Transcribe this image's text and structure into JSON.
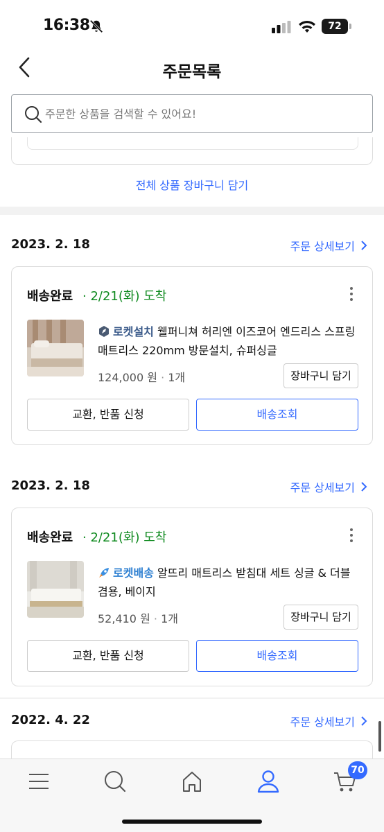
{
  "status_bar": {
    "time": "16:38",
    "battery": "72"
  },
  "header": {
    "title": "주문목록"
  },
  "search": {
    "placeholder": "주문한 상품을 검색할 수 있어요!"
  },
  "prev_card": {
    "cart_all_label": "전체 상품 장바구니 담기"
  },
  "orders": [
    {
      "date": "2023. 2. 18",
      "detail_label": "주문 상세보기",
      "status": "배송완료",
      "arrival": "· 2/21(화) 도착",
      "badge": "로켓설치",
      "badge_icon": "rocket-install-icon",
      "product_name": "웰퍼니쳐 허리엔 이즈코어 엔드리스 스프링 매트리스 220mm 방문설치, 슈퍼싱글",
      "price": "124,000 원",
      "quantity": "1개",
      "cart_label": "장바구니 담기",
      "exchange_label": "교환, 반품 신청",
      "track_label": "배송조회"
    },
    {
      "date": "2023. 2. 18",
      "detail_label": "주문 상세보기",
      "status": "배송완료",
      "arrival": "· 2/21(화) 도착",
      "badge": "로켓배송",
      "badge_icon": "rocket-delivery-icon",
      "product_name": "알뜨리 매트리스 받침대 세트 싱글 & 더블 겸용, 베이지",
      "price": "52,410 원",
      "quantity": "1개",
      "cart_label": "장바구니 담기",
      "exchange_label": "교환, 반품 신청",
      "track_label": "배송조회"
    },
    {
      "date": "2022. 4. 22",
      "detail_label": "주문 상세보기"
    }
  ],
  "tab_bar": {
    "items": [
      "menu-icon",
      "search-icon",
      "home-icon",
      "profile-icon",
      "cart-icon"
    ],
    "cart_count": "70"
  },
  "colors": {
    "accent": "#346aff",
    "arrival_green": "#0f8a1f"
  }
}
